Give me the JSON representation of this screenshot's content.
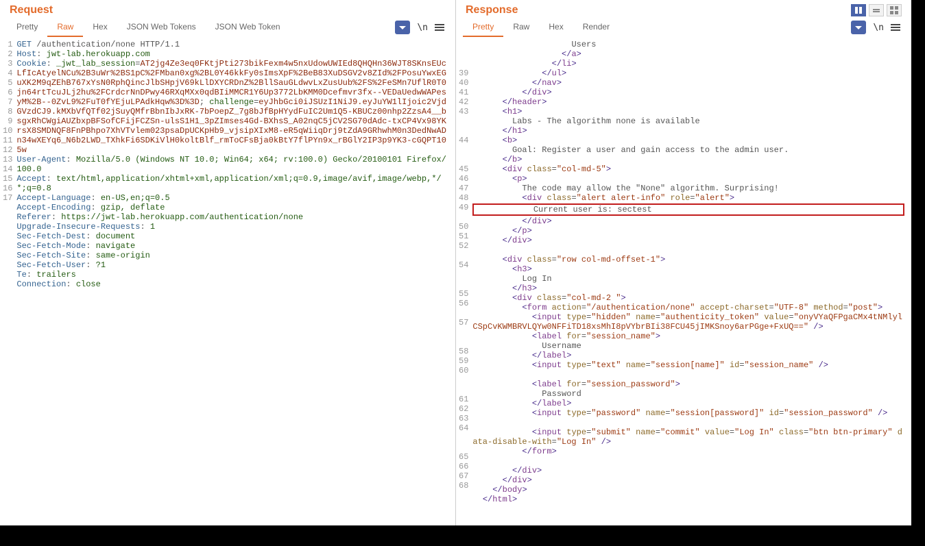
{
  "request": {
    "title": "Request",
    "tabs": {
      "pretty": "Pretty",
      "raw": "Raw",
      "hex": "Hex",
      "jwt_p": "JSON Web Tokens",
      "jwt_s": "JSON Web Token"
    },
    "ln_label": "\\n",
    "lines": [
      {
        "n": 1,
        "type": "reqline",
        "method": "GET",
        "path": "/authentication/none",
        "ver": "HTTP/1.1"
      },
      {
        "n": 2,
        "type": "hdr",
        "name": "Host",
        "val": "jwt-lab.herokuapp.com"
      },
      {
        "n": 3,
        "type": "cookie",
        "name": "Cookie",
        "pairs": [
          {
            "k": "_jwt_lab_session",
            "v": "AT2jg4Ze3eq0FKtjPti273bikFexm4w5nxUdowUWIEd8QHQHn36WJT8SKnsEUcLfIcAtyelNCu%2B3uWr%2BS1pC%2FMban0xg%2BL0Y46kkFy0sImsXpF%2BeB83XuDSGV2v8ZId%2FPosuYwxEGuXK2M9qZEhB767xYsN0RphQincJlbSHpjV69kLlDXYCRDnZ%2BllSauGLdwvLxZusUub%2FS%2FeSMn7UflR0T0jn64rtTcuJLj2hu%2FCrdcrNnDPwy46RXqMXx0qdBIiMMCR1Y6Up3772LbKMM0Dcefmvr3fx--VEDaUedwWAPesyM%2B--0ZvL9%2FuT0fYEjuLPAdkHqw%3D%3D"
          },
          {
            "k": "challenge",
            "v": "eyJhbGci0iJSUzI1NiJ9.eyJuYW1lIjoic2VjdGVzdCJ9.kMXbVfQTf02jSuyQMfrBbnIbJxRK-7bPoepZ_7g8bJfBpHYydFuIC2Um1Q5-KBUCz00nhp2ZzsA4__bsgxRhCWgiAUZbxpBFSofCFijFCZSn-ulsS1H1_3pZImses4Gd-BXhsS_A02nqC5jCV2SG70dAdc-txCP4Vx98YKrsX8SMDNQF8FnPBhpo7XhVTvlem023psaDpUCKpHb9_vjsipXIxM8-eR5qWiiqDrj9tZdA9GRhwhM0n3DedNwADn34wXEYq6_N6b2LWD_TXhkFi6SDKiVlH0koltBlf_rmToCFsBja0kBtY7flPYn9x_rBGlY2IP3p9YK3-cGQPT105w"
          }
        ]
      },
      {
        "n": 4,
        "type": "hdr",
        "name": "User-Agent",
        "val": "Mozilla/5.0 (Windows NT 10.0; Win64; x64; rv:100.0) Gecko/20100101 Firefox/100.0"
      },
      {
        "n": 5,
        "type": "hdr",
        "name": "Accept",
        "val": "text/html,application/xhtml+xml,application/xml;q=0.9,image/avif,image/webp,*/*;q=0.8"
      },
      {
        "n": 6,
        "type": "hdr",
        "name": "Accept-Language",
        "val": "en-US,en;q=0.5"
      },
      {
        "n": 7,
        "type": "hdr",
        "name": "Accept-Encoding",
        "val": "gzip, deflate"
      },
      {
        "n": 8,
        "type": "hdr",
        "name": "Referer",
        "val": "https://jwt-lab.herokuapp.com/authentication/none"
      },
      {
        "n": 9,
        "type": "hdr",
        "name": "Upgrade-Insecure-Requests",
        "val": "1"
      },
      {
        "n": 10,
        "type": "hdr",
        "name": "Sec-Fetch-Dest",
        "val": "document"
      },
      {
        "n": 11,
        "type": "hdr",
        "name": "Sec-Fetch-Mode",
        "val": "navigate"
      },
      {
        "n": 12,
        "type": "hdr",
        "name": "Sec-Fetch-Site",
        "val": "same-origin"
      },
      {
        "n": 13,
        "type": "hdr",
        "name": "Sec-Fetch-User",
        "val": "?1"
      },
      {
        "n": 14,
        "type": "hdr",
        "name": "Te",
        "val": "trailers"
      },
      {
        "n": 15,
        "type": "hdr",
        "name": "Connection",
        "val": "close"
      },
      {
        "n": 16,
        "type": "blank"
      },
      {
        "n": 17,
        "type": "blank"
      }
    ]
  },
  "response": {
    "title": "Response",
    "tabs": {
      "pretty": "Pretty",
      "raw": "Raw",
      "hex": "Hex",
      "render": "Render"
    },
    "ln_label": "\\n",
    "lines": [
      {
        "n": "",
        "i": 10,
        "txt": "Users",
        "plain": true
      },
      {
        "n": "",
        "i": 9,
        "tag": "/a"
      },
      {
        "n": "",
        "i": 8,
        "tag": "/li"
      },
      {
        "n": 39,
        "i": 7,
        "tag": "/ul"
      },
      {
        "n": 40,
        "i": 6,
        "tag": "/nav"
      },
      {
        "n": 41,
        "i": 5,
        "tag": "/div"
      },
      {
        "n": 42,
        "i": 3,
        "tag": "/header"
      },
      {
        "n": 43,
        "i": 3,
        "tag": "h1"
      },
      {
        "n": "",
        "i": 4,
        "txt": "Labs - The algorithm none is available",
        "plain": true
      },
      {
        "n": "",
        "i": 3,
        "tag": "/h1"
      },
      {
        "n": 44,
        "i": 3,
        "tag": "b"
      },
      {
        "n": "",
        "i": 4,
        "txt": "Goal: Register a user and gain access to the admin user.",
        "plain": true
      },
      {
        "n": "",
        "i": 3,
        "tag": "/b"
      },
      {
        "n": 45,
        "i": 3,
        "tag": "div",
        "attrs": [
          [
            "class",
            "col-md-5"
          ]
        ]
      },
      {
        "n": 46,
        "i": 4,
        "tag": "p"
      },
      {
        "n": 47,
        "i": 5,
        "txt": "The code may allow the \"None\" algorithm. Surprising!",
        "plain": true
      },
      {
        "n": 48,
        "i": 5,
        "tag": "div",
        "attrs": [
          [
            "class",
            "alert alert-info"
          ],
          [
            "role",
            "alert"
          ]
        ],
        "hl": "top"
      },
      {
        "n": 49,
        "i": 6,
        "txt": "Current user is: sectest",
        "plain": true,
        "hl": "mid"
      },
      {
        "n": "",
        "i": 5,
        "tag": "/div"
      },
      {
        "n": 50,
        "i": 4,
        "tag": "/p"
      },
      {
        "n": 51,
        "i": 3,
        "tag": "/div"
      },
      {
        "n": 52,
        "i": 0,
        "txt": "",
        "plain": true
      },
      {
        "n": "",
        "i": 3,
        "tag": "div",
        "attrs": [
          [
            "class",
            "row col-md-offset-1"
          ]
        ]
      },
      {
        "n": 53,
        "i": 0,
        "txt": "",
        "nop": true
      },
      {
        "n": 54,
        "i": 4,
        "tag": "h3"
      },
      {
        "n": "",
        "i": 5,
        "txt": "Log In",
        "plain": true
      },
      {
        "n": "",
        "i": 4,
        "tag": "/h3"
      },
      {
        "n": 55,
        "i": 4,
        "tag": "div",
        "attrs": [
          [
            "class",
            "col-md-2 "
          ]
        ]
      },
      {
        "n": 56,
        "i": 5,
        "tag": "form",
        "attrs": [
          [
            "action",
            "/authentication/none"
          ],
          [
            "accept-charset",
            "UTF-8"
          ],
          [
            "method",
            "post"
          ]
        ]
      },
      {
        "n": "",
        "i": 6,
        "tag": "input",
        "attrs": [
          [
            "type",
            "hidden"
          ],
          [
            "name",
            "authenticity_token"
          ],
          [
            "value",
            "onyVYaQFPgaCMx4tNMlylCSpCvKWMBRVLQYw0NFFiTD18xsMhI8pVYbrBIi38FCU45jIMKSnoy6arPGge+FxUQ=="
          ]
        ],
        "self": true
      },
      {
        "n": 57,
        "i": 6,
        "tag": "label",
        "attrs": [
          [
            "for",
            "session_name"
          ]
        ]
      },
      {
        "n": "",
        "i": 7,
        "txt": "Username",
        "plain": true
      },
      {
        "n": "",
        "i": 6,
        "tag": "/label"
      },
      {
        "n": 58,
        "i": 6,
        "tag": "input",
        "attrs": [
          [
            "type",
            "text"
          ],
          [
            "name",
            "session[name]"
          ],
          [
            "id",
            "session_name"
          ]
        ],
        "self": true
      },
      {
        "n": 59,
        "i": 0,
        "txt": "",
        "plain": true
      },
      {
        "n": 60,
        "i": 6,
        "tag": "label",
        "attrs": [
          [
            "for",
            "session_password"
          ]
        ]
      },
      {
        "n": "",
        "i": 7,
        "txt": "Password",
        "plain": true
      },
      {
        "n": "",
        "i": 6,
        "tag": "/label"
      },
      {
        "n": 61,
        "i": 6,
        "tag": "input",
        "attrs": [
          [
            "type",
            "password"
          ],
          [
            "name",
            "session[password]"
          ],
          [
            "id",
            "session_password"
          ]
        ],
        "self": true
      },
      {
        "n": 62,
        "i": 0,
        "txt": "",
        "plain": true
      },
      {
        "n": 63,
        "i": 6,
        "tag": "input",
        "attrs": [
          [
            "type",
            "submit"
          ],
          [
            "name",
            "commit"
          ],
          [
            "value",
            "Log In"
          ],
          [
            "class",
            "btn btn-primary"
          ],
          [
            "data-disable-with",
            "Log In"
          ]
        ],
        "self": true
      },
      {
        "n": 64,
        "i": 5,
        "tag": "/form"
      },
      {
        "n": "",
        "i": 0,
        "txt": "",
        "plain": true
      },
      {
        "n": "",
        "i": 4,
        "tag": "/div"
      },
      {
        "n": 65,
        "i": 3,
        "tag": "/div"
      },
      {
        "n": 66,
        "i": 2,
        "tag": "/body"
      },
      {
        "n": 67,
        "i": 1,
        "tag": "/html"
      },
      {
        "n": 68,
        "i": 0,
        "txt": "",
        "plain": true
      }
    ]
  }
}
